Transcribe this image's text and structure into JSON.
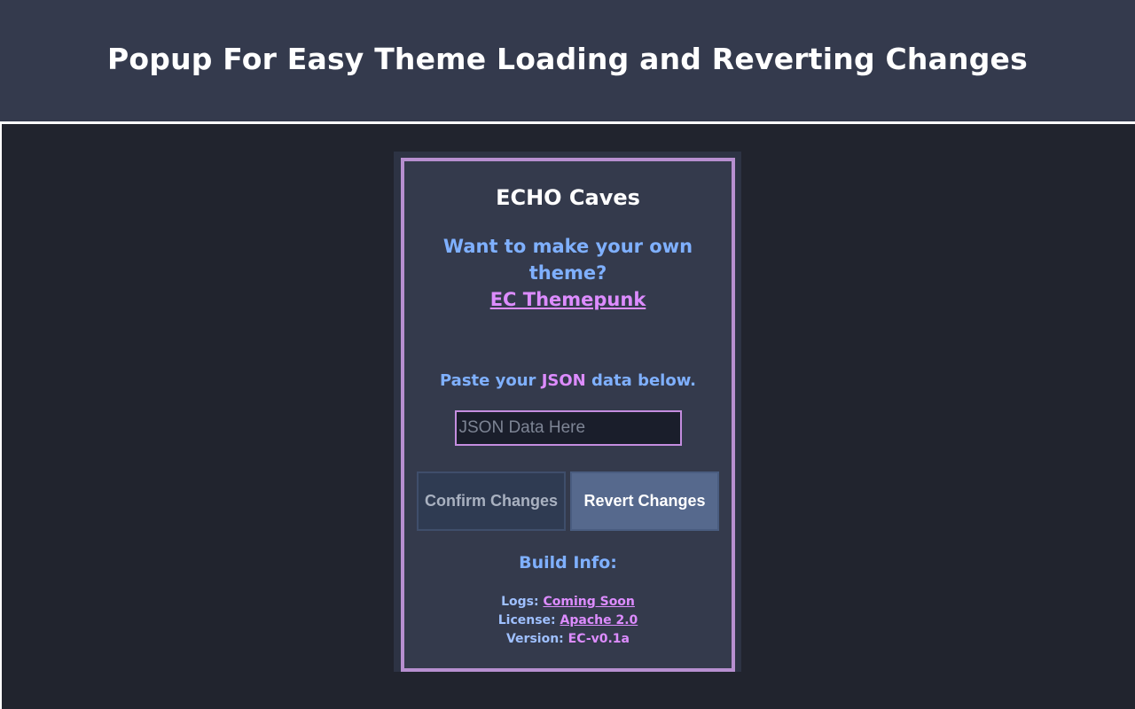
{
  "banner": {
    "title": "Popup For Easy Theme Loading and Reverting Changes"
  },
  "popup": {
    "title": "ECHO Caves",
    "promo_text": "Want to make your own theme?",
    "promo_link": "EC Themepunk",
    "paste_prefix": "Paste your",
    "paste_highlight": "JSON",
    "paste_suffix": "data below.",
    "json_placeholder": "JSON Data Here",
    "json_value": "",
    "confirm_label": "Confirm Changes",
    "revert_label": "Revert Changes",
    "build_title": "Build Info:",
    "logs_label": "Logs:",
    "logs_value": "Coming Soon",
    "license_label": "License:",
    "license_value": "Apache 2.0",
    "version_label": "Version:",
    "version_value": "EC-v0.1a"
  },
  "colors": {
    "banner_bg": "#343a4d",
    "stage_bg": "#21242e",
    "popup_border": "#b78fd0",
    "accent_blue": "#7fb0ff",
    "accent_purple": "#dd8cff"
  }
}
